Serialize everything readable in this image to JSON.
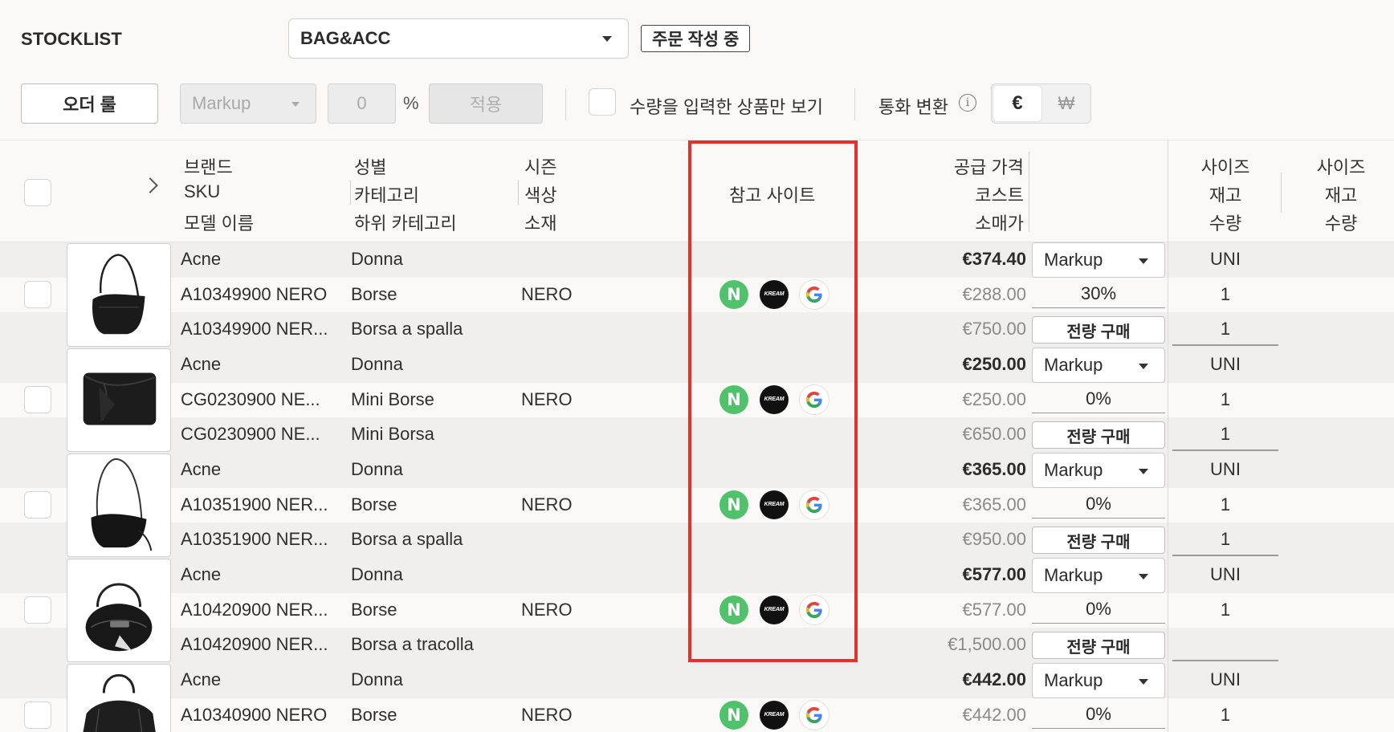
{
  "header": {
    "title": "STOCKLIST",
    "category": "BAG&ACC",
    "status_badge": "주문 작성 중"
  },
  "toolbar": {
    "order_rule_label": "오더 룰",
    "markup_placeholder": "Markup",
    "percent_value": "0",
    "percent_sign": "%",
    "apply_label": "적용",
    "qty_filter_label": "수량을 입력한 상품만 보기",
    "currency_label": "통화 변환",
    "info_glyph": "i",
    "currency_eur": "€",
    "currency_krw": "₩"
  },
  "columns": {
    "brand": "브랜드",
    "sku": "SKU",
    "model": "모델 이름",
    "gender": "성별",
    "category": "카테고리",
    "subcategory": "하위 카테고리",
    "season": "시즌",
    "color": "색상",
    "material": "소재",
    "ref_sites": "참고 사이트",
    "supply_price": "공급 가격",
    "cost": "코스트",
    "retail": "소매가",
    "size1": "사이즈",
    "stock1": "재고",
    "qty1": "수량",
    "size2": "사이즈",
    "stock2": "재고",
    "qty2": "수량"
  },
  "site_icons": {
    "naver": "N",
    "kream": "KREAM"
  },
  "products": [
    {
      "brand": "Acne",
      "sku": "A10349900 NERO",
      "model": "A10349900 NER...",
      "gender": "Donna",
      "category": "Borse",
      "subcategory": "Borsa a spalla",
      "color": "NERO",
      "supply_price": "€374.40",
      "cost": "€288.00",
      "retail": "€750.00",
      "markup_mode": "Markup",
      "markup_pct": "30%",
      "bulk_label": "전량 구매",
      "size": "UNI",
      "stock": "1",
      "qty": "1",
      "bag": "hobo"
    },
    {
      "brand": "Acne",
      "sku": "CG0230900 NE...",
      "model": "CG0230900 NE...",
      "gender": "Donna",
      "category": "Mini Borse",
      "subcategory": "Mini Borsa",
      "color": "NERO",
      "supply_price": "€250.00",
      "cost": "€250.00",
      "retail": "€650.00",
      "markup_mode": "Markup",
      "markup_pct": "0%",
      "bulk_label": "전량 구매",
      "size": "UNI",
      "stock": "1",
      "qty": "1",
      "bag": "clutch"
    },
    {
      "brand": "Acne",
      "sku": "A10351900 NER...",
      "model": "A10351900 NER...",
      "gender": "Donna",
      "category": "Borse",
      "subcategory": "Borsa a spalla",
      "color": "NERO",
      "supply_price": "€365.00",
      "cost": "€365.00",
      "retail": "€950.00",
      "markup_mode": "Markup",
      "markup_pct": "0%",
      "bulk_label": "전량 구매",
      "size": "UNI",
      "stock": "1",
      "qty": "1",
      "bag": "baguette"
    },
    {
      "brand": "Acne",
      "sku": "A10420900 NER...",
      "model": "A10420900 NER...",
      "gender": "Donna",
      "category": "Borse",
      "subcategory": "Borsa a tracolla",
      "color": "NERO",
      "supply_price": "€577.00",
      "cost": "€577.00",
      "retail": "€1,500.00",
      "markup_mode": "Markup",
      "markup_pct": "0%",
      "bulk_label": "전량 구매",
      "size": "UNI",
      "stock": "1",
      "qty": "",
      "bag": "round"
    },
    {
      "brand": "Acne",
      "sku": "A10340900 NERO",
      "model": "",
      "gender": "Donna",
      "category": "Borse",
      "subcategory": "",
      "color": "NERO",
      "supply_price": "€442.00",
      "cost": "€442.00",
      "retail": "",
      "markup_mode": "Markup",
      "markup_pct": "0%",
      "bulk_label": "",
      "size": "UNI",
      "stock": "1",
      "qty": "",
      "bag": "tote"
    }
  ],
  "colors": {
    "highlight": "#e5312b",
    "naver_green": "#4fc26b",
    "kream_black": "#111111"
  }
}
